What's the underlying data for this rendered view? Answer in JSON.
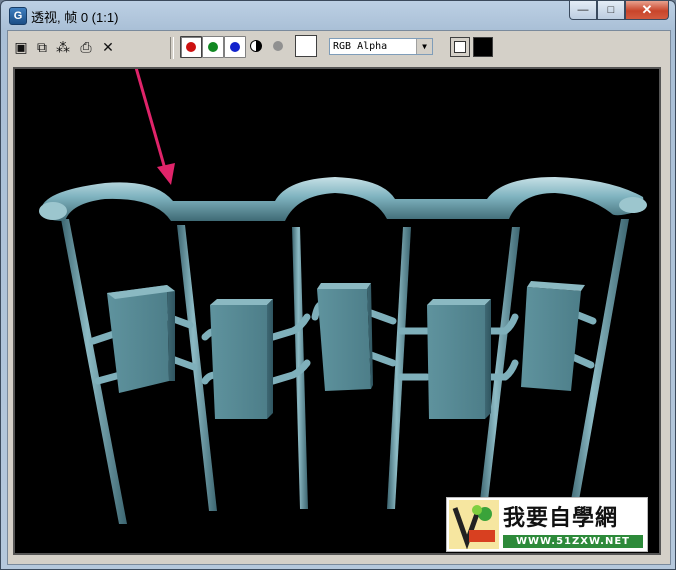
{
  "window": {
    "title": "透视, 帧 0 (1:1)",
    "app_icon_letter": "G",
    "controls": {
      "minimize": "—",
      "maximize": "□",
      "close": "✕"
    }
  },
  "toolbar": {
    "icons": [
      "save-icon",
      "copy-icon",
      "clone-icon",
      "print-icon",
      "clear-icon"
    ],
    "icon_glyphs": {
      "save": "▣",
      "copy": "⧉",
      "clone": "⁂",
      "print": "⎙",
      "clear": "✕"
    },
    "channels": [
      {
        "name": "red-channel",
        "color": "#cc1111",
        "pressed": true
      },
      {
        "name": "green-channel",
        "color": "#118822",
        "pressed": false
      },
      {
        "name": "blue-channel",
        "color": "#1122cc",
        "pressed": false
      }
    ],
    "channel_display": "RGB Alpha",
    "swatch_color": "#ffffff"
  },
  "viewport": {
    "background": "#000000",
    "model_color": "#6fa4b0",
    "arrow_color": "#e0246a"
  },
  "watermark": {
    "text": "我要自學網",
    "url": "WWW.51ZXW.NET"
  }
}
